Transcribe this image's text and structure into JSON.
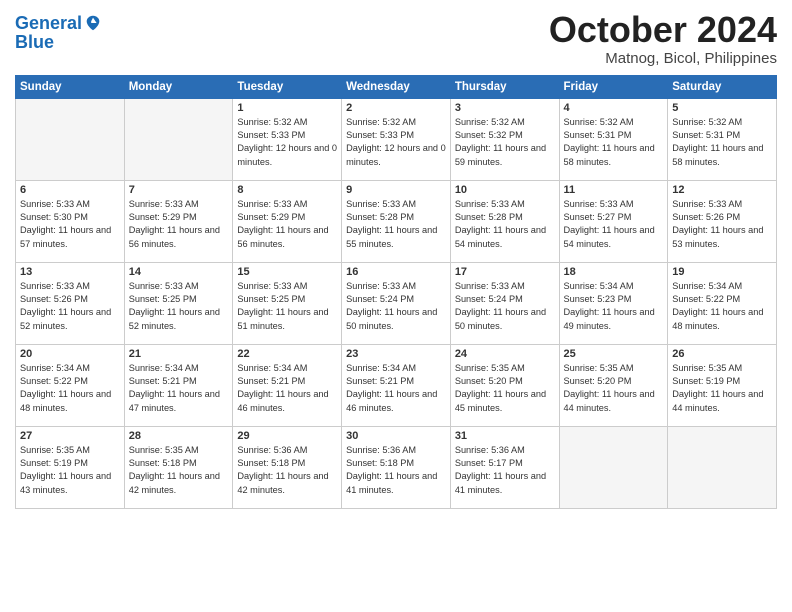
{
  "header": {
    "logo_line1": "General",
    "logo_line2": "Blue",
    "month": "October 2024",
    "location": "Matnog, Bicol, Philippines"
  },
  "weekdays": [
    "Sunday",
    "Monday",
    "Tuesday",
    "Wednesday",
    "Thursday",
    "Friday",
    "Saturday"
  ],
  "weeks": [
    [
      {
        "day": "",
        "sunrise": "",
        "sunset": "",
        "daylight": ""
      },
      {
        "day": "",
        "sunrise": "",
        "sunset": "",
        "daylight": ""
      },
      {
        "day": "1",
        "sunrise": "Sunrise: 5:32 AM",
        "sunset": "Sunset: 5:33 PM",
        "daylight": "Daylight: 12 hours and 0 minutes."
      },
      {
        "day": "2",
        "sunrise": "Sunrise: 5:32 AM",
        "sunset": "Sunset: 5:33 PM",
        "daylight": "Daylight: 12 hours and 0 minutes."
      },
      {
        "day": "3",
        "sunrise": "Sunrise: 5:32 AM",
        "sunset": "Sunset: 5:32 PM",
        "daylight": "Daylight: 11 hours and 59 minutes."
      },
      {
        "day": "4",
        "sunrise": "Sunrise: 5:32 AM",
        "sunset": "Sunset: 5:31 PM",
        "daylight": "Daylight: 11 hours and 58 minutes."
      },
      {
        "day": "5",
        "sunrise": "Sunrise: 5:32 AM",
        "sunset": "Sunset: 5:31 PM",
        "daylight": "Daylight: 11 hours and 58 minutes."
      }
    ],
    [
      {
        "day": "6",
        "sunrise": "Sunrise: 5:33 AM",
        "sunset": "Sunset: 5:30 PM",
        "daylight": "Daylight: 11 hours and 57 minutes."
      },
      {
        "day": "7",
        "sunrise": "Sunrise: 5:33 AM",
        "sunset": "Sunset: 5:29 PM",
        "daylight": "Daylight: 11 hours and 56 minutes."
      },
      {
        "day": "8",
        "sunrise": "Sunrise: 5:33 AM",
        "sunset": "Sunset: 5:29 PM",
        "daylight": "Daylight: 11 hours and 56 minutes."
      },
      {
        "day": "9",
        "sunrise": "Sunrise: 5:33 AM",
        "sunset": "Sunset: 5:28 PM",
        "daylight": "Daylight: 11 hours and 55 minutes."
      },
      {
        "day": "10",
        "sunrise": "Sunrise: 5:33 AM",
        "sunset": "Sunset: 5:28 PM",
        "daylight": "Daylight: 11 hours and 54 minutes."
      },
      {
        "day": "11",
        "sunrise": "Sunrise: 5:33 AM",
        "sunset": "Sunset: 5:27 PM",
        "daylight": "Daylight: 11 hours and 54 minutes."
      },
      {
        "day": "12",
        "sunrise": "Sunrise: 5:33 AM",
        "sunset": "Sunset: 5:26 PM",
        "daylight": "Daylight: 11 hours and 53 minutes."
      }
    ],
    [
      {
        "day": "13",
        "sunrise": "Sunrise: 5:33 AM",
        "sunset": "Sunset: 5:26 PM",
        "daylight": "Daylight: 11 hours and 52 minutes."
      },
      {
        "day": "14",
        "sunrise": "Sunrise: 5:33 AM",
        "sunset": "Sunset: 5:25 PM",
        "daylight": "Daylight: 11 hours and 52 minutes."
      },
      {
        "day": "15",
        "sunrise": "Sunrise: 5:33 AM",
        "sunset": "Sunset: 5:25 PM",
        "daylight": "Daylight: 11 hours and 51 minutes."
      },
      {
        "day": "16",
        "sunrise": "Sunrise: 5:33 AM",
        "sunset": "Sunset: 5:24 PM",
        "daylight": "Daylight: 11 hours and 50 minutes."
      },
      {
        "day": "17",
        "sunrise": "Sunrise: 5:33 AM",
        "sunset": "Sunset: 5:24 PM",
        "daylight": "Daylight: 11 hours and 50 minutes."
      },
      {
        "day": "18",
        "sunrise": "Sunrise: 5:34 AM",
        "sunset": "Sunset: 5:23 PM",
        "daylight": "Daylight: 11 hours and 49 minutes."
      },
      {
        "day": "19",
        "sunrise": "Sunrise: 5:34 AM",
        "sunset": "Sunset: 5:22 PM",
        "daylight": "Daylight: 11 hours and 48 minutes."
      }
    ],
    [
      {
        "day": "20",
        "sunrise": "Sunrise: 5:34 AM",
        "sunset": "Sunset: 5:22 PM",
        "daylight": "Daylight: 11 hours and 48 minutes."
      },
      {
        "day": "21",
        "sunrise": "Sunrise: 5:34 AM",
        "sunset": "Sunset: 5:21 PM",
        "daylight": "Daylight: 11 hours and 47 minutes."
      },
      {
        "day": "22",
        "sunrise": "Sunrise: 5:34 AM",
        "sunset": "Sunset: 5:21 PM",
        "daylight": "Daylight: 11 hours and 46 minutes."
      },
      {
        "day": "23",
        "sunrise": "Sunrise: 5:34 AM",
        "sunset": "Sunset: 5:21 PM",
        "daylight": "Daylight: 11 hours and 46 minutes."
      },
      {
        "day": "24",
        "sunrise": "Sunrise: 5:35 AM",
        "sunset": "Sunset: 5:20 PM",
        "daylight": "Daylight: 11 hours and 45 minutes."
      },
      {
        "day": "25",
        "sunrise": "Sunrise: 5:35 AM",
        "sunset": "Sunset: 5:20 PM",
        "daylight": "Daylight: 11 hours and 44 minutes."
      },
      {
        "day": "26",
        "sunrise": "Sunrise: 5:35 AM",
        "sunset": "Sunset: 5:19 PM",
        "daylight": "Daylight: 11 hours and 44 minutes."
      }
    ],
    [
      {
        "day": "27",
        "sunrise": "Sunrise: 5:35 AM",
        "sunset": "Sunset: 5:19 PM",
        "daylight": "Daylight: 11 hours and 43 minutes."
      },
      {
        "day": "28",
        "sunrise": "Sunrise: 5:35 AM",
        "sunset": "Sunset: 5:18 PM",
        "daylight": "Daylight: 11 hours and 42 minutes."
      },
      {
        "day": "29",
        "sunrise": "Sunrise: 5:36 AM",
        "sunset": "Sunset: 5:18 PM",
        "daylight": "Daylight: 11 hours and 42 minutes."
      },
      {
        "day": "30",
        "sunrise": "Sunrise: 5:36 AM",
        "sunset": "Sunset: 5:18 PM",
        "daylight": "Daylight: 11 hours and 41 minutes."
      },
      {
        "day": "31",
        "sunrise": "Sunrise: 5:36 AM",
        "sunset": "Sunset: 5:17 PM",
        "daylight": "Daylight: 11 hours and 41 minutes."
      },
      {
        "day": "",
        "sunrise": "",
        "sunset": "",
        "daylight": ""
      },
      {
        "day": "",
        "sunrise": "",
        "sunset": "",
        "daylight": ""
      }
    ]
  ]
}
